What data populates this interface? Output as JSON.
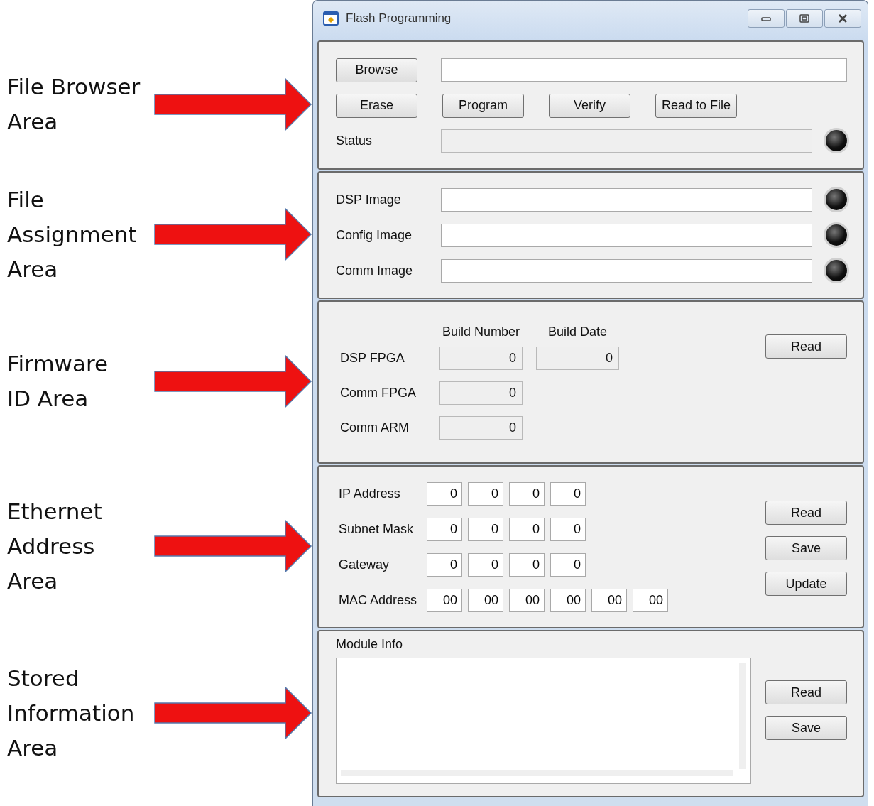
{
  "annotations": [
    {
      "lines": [
        "File Browser",
        "Area"
      ]
    },
    {
      "lines": [
        "File",
        "Assignment",
        "Area"
      ]
    },
    {
      "lines": [
        "Firmware",
        "ID Area"
      ]
    },
    {
      "lines": [
        "Ethernet",
        "Address",
        "Area"
      ]
    },
    {
      "lines": [
        "Stored",
        "Information",
        "Area"
      ]
    }
  ],
  "window": {
    "title": "Flash Programming"
  },
  "file_browser": {
    "browse": {
      "label": "Browse"
    },
    "actions": [
      {
        "label": "Erase"
      },
      {
        "label": "Program"
      },
      {
        "label": "Verify"
      },
      {
        "label": "Read to File"
      }
    ],
    "status_label": "Status",
    "status_lit": false
  },
  "file_assignment": {
    "rows": [
      {
        "label": "DSP Image",
        "lit": false
      },
      {
        "label": "Config Image",
        "lit": false
      },
      {
        "label": "Comm Image",
        "lit": false
      }
    ]
  },
  "firmware_id": {
    "columns": [
      "Build Number",
      "Build Date"
    ],
    "rows": [
      {
        "label": "DSP FPGA",
        "build_number": "0",
        "build_date": "0"
      },
      {
        "label": "Comm FPGA",
        "build_number": "0"
      },
      {
        "label": "Comm ARM",
        "build_number": "0"
      }
    ],
    "read": {
      "label": "Read"
    }
  },
  "ethernet": {
    "rows": [
      {
        "label": "IP Address",
        "octets": [
          "0",
          "0",
          "0",
          "0"
        ]
      },
      {
        "label": "Subnet Mask",
        "octets": [
          "0",
          "0",
          "0",
          "0"
        ]
      },
      {
        "label": "Gateway",
        "octets": [
          "0",
          "0",
          "0",
          "0"
        ]
      },
      {
        "label": "MAC Address",
        "octets": [
          "00",
          "00",
          "00",
          "00",
          "00",
          "00"
        ]
      }
    ],
    "buttons": [
      {
        "label": "Read"
      },
      {
        "label": "Save"
      },
      {
        "label": "Update"
      }
    ]
  },
  "module_info": {
    "label": "Module Info",
    "buttons": [
      {
        "label": "Read"
      },
      {
        "label": "Save"
      }
    ]
  }
}
